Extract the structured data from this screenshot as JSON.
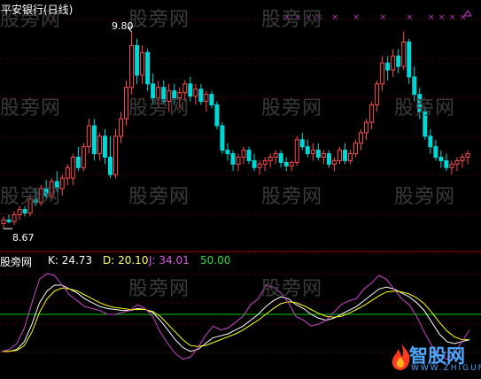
{
  "title": "平安银行(日线)",
  "watermarks": [
    "股旁网",
    "股旁网",
    "股旁网",
    "股旁网",
    "股旁网",
    "股旁网",
    "股旁网",
    "股旁网",
    "股旁网",
    "股旁网",
    "股旁网",
    "股旁网",
    "股旁网"
  ],
  "kdj_header": {
    "name": "股旁网",
    "k": "K: 24.73",
    "d": "D: 20.10",
    "j": "J: 34.01",
    "line": "50.00"
  },
  "annotations": {
    "high": "9.80",
    "low": "8.67"
  },
  "brand": {
    "name": "智股网",
    "url": "WWW.ZHIGUF.COM",
    "logo": "fire-logo"
  },
  "colors": {
    "up": "#ff4a4a",
    "down": "#00d8d8",
    "k": "#ffffff",
    "d": "#ffff00",
    "j": "#cc44cc",
    "ref": "#00cc00",
    "grid": "#7a0000",
    "marker": "#cc33cc"
  },
  "chart_data": [
    {
      "type": "candlestick",
      "title": "平安银行(日线)",
      "y_max_label": "9.80",
      "y_min_label": "8.67",
      "ylim": [
        8.6,
        9.9
      ],
      "series": [
        {
          "values": [
            [
              8.7,
              8.74,
              8.67,
              8.72
            ],
            [
              8.72,
              8.75,
              8.7,
              8.71
            ],
            [
              8.71,
              8.77,
              8.69,
              8.75
            ],
            [
              8.75,
              8.8,
              8.72,
              8.78
            ],
            [
              8.78,
              8.8,
              8.74,
              8.76
            ],
            [
              8.76,
              8.86,
              8.74,
              8.84
            ],
            [
              8.84,
              8.9,
              8.8,
              8.82
            ],
            [
              8.82,
              8.92,
              8.8,
              8.9
            ],
            [
              8.9,
              8.95,
              8.84,
              8.86
            ],
            [
              8.86,
              8.96,
              8.84,
              8.94
            ],
            [
              8.94,
              9.0,
              8.88,
              8.9
            ],
            [
              8.9,
              8.98,
              8.86,
              8.96
            ],
            [
              8.96,
              9.04,
              8.92,
              9.02
            ],
            [
              8.96,
              9.1,
              8.92,
              9.08
            ],
            [
              9.08,
              9.14,
              9.0,
              9.02
            ],
            [
              9.02,
              9.16,
              9.0,
              9.14
            ],
            [
              9.14,
              9.3,
              9.1,
              9.26
            ],
            [
              9.26,
              9.3,
              9.06,
              9.1
            ],
            [
              9.1,
              9.22,
              9.06,
              9.2
            ],
            [
              9.2,
              9.24,
              9.04,
              9.08
            ],
            [
              9.08,
              9.2,
              8.96,
              8.98
            ],
            [
              8.98,
              9.24,
              8.96,
              9.2
            ],
            [
              9.2,
              9.34,
              9.16,
              9.3
            ],
            [
              9.3,
              9.52,
              9.26,
              9.48
            ],
            [
              9.48,
              9.8,
              9.44,
              9.72
            ],
            [
              9.72,
              9.76,
              9.5,
              9.55
            ],
            [
              9.55,
              9.72,
              9.5,
              9.68
            ],
            [
              9.68,
              9.7,
              9.46,
              9.5
            ],
            [
              9.5,
              9.56,
              9.38,
              9.42
            ],
            [
              9.42,
              9.52,
              9.36,
              9.48
            ],
            [
              9.48,
              9.52,
              9.38,
              9.4
            ],
            [
              9.4,
              9.5,
              9.34,
              9.46
            ],
            [
              9.46,
              9.5,
              9.38,
              9.42
            ],
            [
              9.42,
              9.48,
              9.36,
              9.45
            ],
            [
              9.45,
              9.52,
              9.4,
              9.5
            ],
            [
              9.5,
              9.54,
              9.4,
              9.43
            ],
            [
              9.43,
              9.5,
              9.38,
              9.47
            ],
            [
              9.47,
              9.5,
              9.38,
              9.4
            ],
            [
              9.4,
              9.46,
              9.34,
              9.44
            ],
            [
              9.44,
              9.46,
              9.36,
              9.38
            ],
            [
              9.38,
              9.4,
              9.24,
              9.26
            ],
            [
              9.26,
              9.28,
              9.1,
              9.12
            ],
            [
              9.12,
              9.16,
              9.06,
              9.1
            ],
            [
              9.1,
              9.12,
              9.0,
              9.04
            ],
            [
              9.04,
              9.1,
              9.0,
              9.08
            ],
            [
              9.08,
              9.14,
              9.04,
              9.12
            ],
            [
              9.12,
              9.14,
              9.04,
              9.06
            ],
            [
              9.06,
              9.1,
              9.0,
              9.02
            ],
            [
              9.02,
              9.06,
              8.98,
              9.04
            ],
            [
              9.04,
              9.08,
              9.0,
              9.06
            ],
            [
              9.06,
              9.1,
              9.02,
              9.08
            ],
            [
              9.08,
              9.12,
              9.04,
              9.1
            ],
            [
              9.1,
              9.12,
              9.02,
              9.05
            ],
            [
              9.05,
              9.08,
              9.0,
              9.03
            ],
            [
              9.03,
              9.06,
              9.0,
              9.05
            ],
            [
              9.05,
              9.2,
              9.03,
              9.18
            ],
            [
              9.18,
              9.22,
              9.12,
              9.14
            ],
            [
              9.14,
              9.18,
              9.08,
              9.1
            ],
            [
              9.1,
              9.16,
              9.06,
              9.12
            ],
            [
              9.12,
              9.16,
              9.06,
              9.08
            ],
            [
              9.08,
              9.12,
              9.04,
              9.1
            ],
            [
              9.1,
              9.12,
              9.02,
              9.04
            ],
            [
              9.04,
              9.08,
              9.0,
              9.06
            ],
            [
              9.06,
              9.14,
              9.04,
              9.12
            ],
            [
              9.12,
              9.16,
              9.04,
              9.06
            ],
            [
              9.06,
              9.12,
              9.04,
              9.1
            ],
            [
              9.1,
              9.18,
              9.08,
              9.16
            ],
            [
              9.16,
              9.24,
              9.12,
              9.22
            ],
            [
              9.22,
              9.3,
              9.18,
              9.28
            ],
            [
              9.28,
              9.4,
              9.24,
              9.38
            ],
            [
              9.38,
              9.52,
              9.34,
              9.5
            ],
            [
              9.5,
              9.66,
              9.46,
              9.62
            ],
            [
              9.62,
              9.66,
              9.52,
              9.58
            ],
            [
              9.58,
              9.7,
              9.54,
              9.66
            ],
            [
              9.66,
              9.7,
              9.56,
              9.6
            ],
            [
              9.6,
              9.8,
              9.58,
              9.74
            ],
            [
              9.74,
              9.76,
              9.5,
              9.54
            ],
            [
              9.54,
              9.6,
              9.4,
              9.44
            ],
            [
              9.44,
              9.48,
              9.3,
              9.34
            ],
            [
              9.34,
              9.36,
              9.18,
              9.2
            ],
            [
              9.2,
              9.24,
              9.1,
              9.14
            ],
            [
              9.14,
              9.18,
              9.06,
              9.08
            ],
            [
              9.08,
              9.12,
              9.02,
              9.06
            ],
            [
              9.06,
              9.1,
              9.0,
              9.02
            ],
            [
              9.02,
              9.06,
              8.98,
              9.04
            ],
            [
              9.04,
              9.08,
              9.0,
              9.06
            ],
            [
              9.06,
              9.1,
              9.02,
              9.08
            ],
            [
              9.08,
              9.12,
              9.04,
              9.1
            ]
          ]
        }
      ]
    },
    {
      "type": "line",
      "title": "股旁网",
      "ylim": [
        0,
        100
      ],
      "reference": 50.0,
      "series": [
        {
          "name": "K",
          "values": [
            12,
            12,
            14,
            22,
            40,
            62,
            74,
            80,
            80,
            76,
            72,
            66,
            62,
            58,
            56,
            55,
            54,
            54,
            56,
            55,
            52,
            44,
            34,
            24,
            16,
            12,
            14,
            20,
            26,
            28,
            30,
            34,
            38,
            44,
            50,
            58,
            64,
            68,
            66,
            60,
            56,
            50,
            46,
            44,
            46,
            50,
            54,
            58,
            64,
            70,
            76,
            78,
            76,
            72,
            68,
            62,
            54,
            42,
            30,
            22,
            20,
            22,
            24
          ]
        },
        {
          "name": "D",
          "values": [
            12,
            12,
            13,
            18,
            32,
            52,
            66,
            74,
            77,
            76,
            74,
            70,
            66,
            62,
            59,
            57,
            56,
            55,
            55,
            55,
            53,
            48,
            40,
            32,
            24,
            18,
            17,
            18,
            21,
            24,
            27,
            30,
            34,
            39,
            44,
            50,
            56,
            61,
            63,
            62,
            59,
            55,
            51,
            48,
            47,
            48,
            51,
            55,
            59,
            64,
            69,
            73,
            74,
            73,
            71,
            67,
            61,
            52,
            42,
            33,
            27,
            24,
            24
          ]
        },
        {
          "name": "J",
          "values": [
            12,
            14,
            20,
            36,
            62,
            86,
            92,
            90,
            80,
            70,
            64,
            58,
            56,
            54,
            50,
            50,
            52,
            54,
            60,
            56,
            48,
            32,
            20,
            10,
            4,
            6,
            16,
            28,
            38,
            34,
            36,
            42,
            48,
            60,
            66,
            80,
            78,
            72,
            62,
            48,
            44,
            38,
            40,
            44,
            52,
            60,
            64,
            66,
            76,
            82,
            90,
            86,
            76,
            66,
            60,
            48,
            32,
            18,
            8,
            4,
            10,
            22,
            34
          ]
        }
      ]
    }
  ]
}
